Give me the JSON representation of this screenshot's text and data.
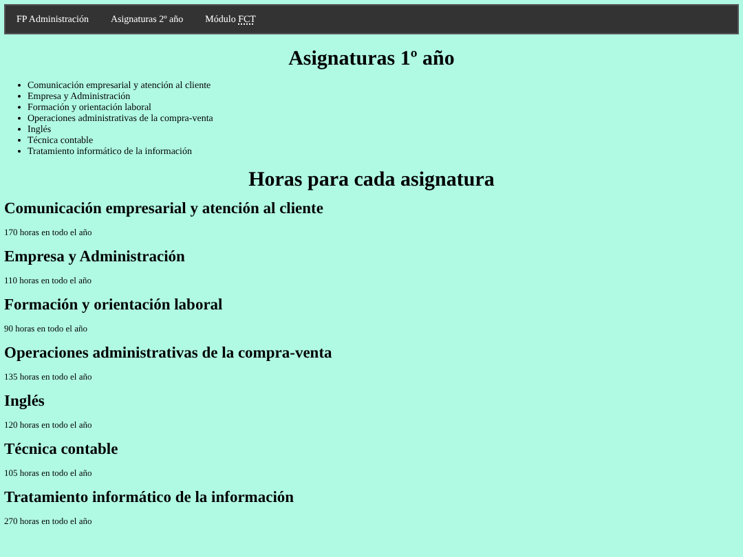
{
  "nav": {
    "items": [
      {
        "text": "FP Administración"
      },
      {
        "text": "Asignaturas 2º año"
      },
      {
        "text": "Módulo ",
        "abbr": "FCT"
      }
    ]
  },
  "title": "Asignaturas 1º año",
  "subjects": [
    "Comunicación empresarial y atención al cliente",
    "Empresa y Administración",
    "Formación y orientación laboral",
    "Operaciones administrativas de la compra-venta",
    "Inglés",
    "Técnica contable",
    "Tratamiento informático de la información"
  ],
  "hours_title": "Horas para cada asignatura",
  "hours": [
    {
      "subject": "Comunicación empresarial y atención al cliente",
      "text": "170 horas en todo el año"
    },
    {
      "subject": "Empresa y Administración",
      "text": "110 horas en todo el año"
    },
    {
      "subject": "Formación y orientación laboral",
      "text": "90 horas en todo el año"
    },
    {
      "subject": "Operaciones administrativas de la compra-venta",
      "text": "135 horas en todo el año"
    },
    {
      "subject": "Inglés",
      "text": "120 horas en todo el año"
    },
    {
      "subject": "Técnica contable",
      "text": "105 horas en todo el año"
    },
    {
      "subject": "Tratamiento informático de la información",
      "text": "270 horas en todo el año"
    }
  ]
}
